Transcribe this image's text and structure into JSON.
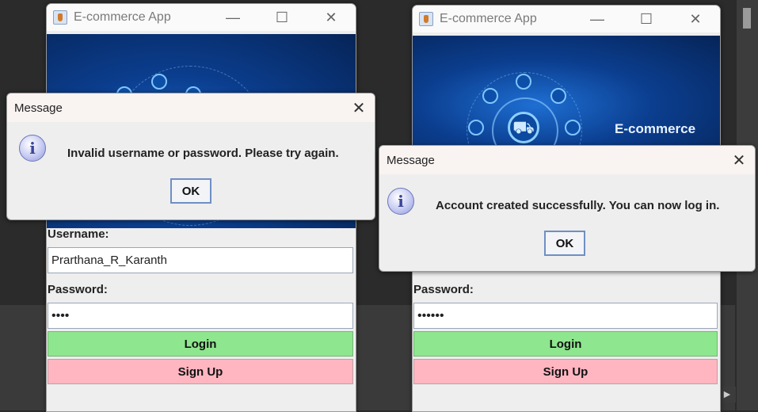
{
  "left": {
    "window_title": "E-commerce App",
    "username_label": "Username:",
    "username_value": "Prarthana_R_Karanth",
    "password_label": "Password:",
    "password_value": "••••",
    "login_label": "Login",
    "signup_label": "Sign Up",
    "dialog": {
      "title": "Message",
      "message": "Invalid username or password. Please try again.",
      "ok_label": "OK"
    }
  },
  "right": {
    "window_title": "E-commerce App",
    "banner_text": "E-commerce",
    "password_label": "Password:",
    "password_value": "••••••",
    "login_label": "Login",
    "signup_label": "Sign Up",
    "dialog": {
      "title": "Message",
      "message": "Account created successfully. You can now log in.",
      "ok_label": "OK"
    }
  },
  "window_controls": {
    "minimize": "—",
    "maximize": "☐",
    "close": "✕"
  },
  "colors": {
    "login_bg": "#8ee68e",
    "signup_bg": "#ffb6c1",
    "banner": "#0b3e8f"
  }
}
